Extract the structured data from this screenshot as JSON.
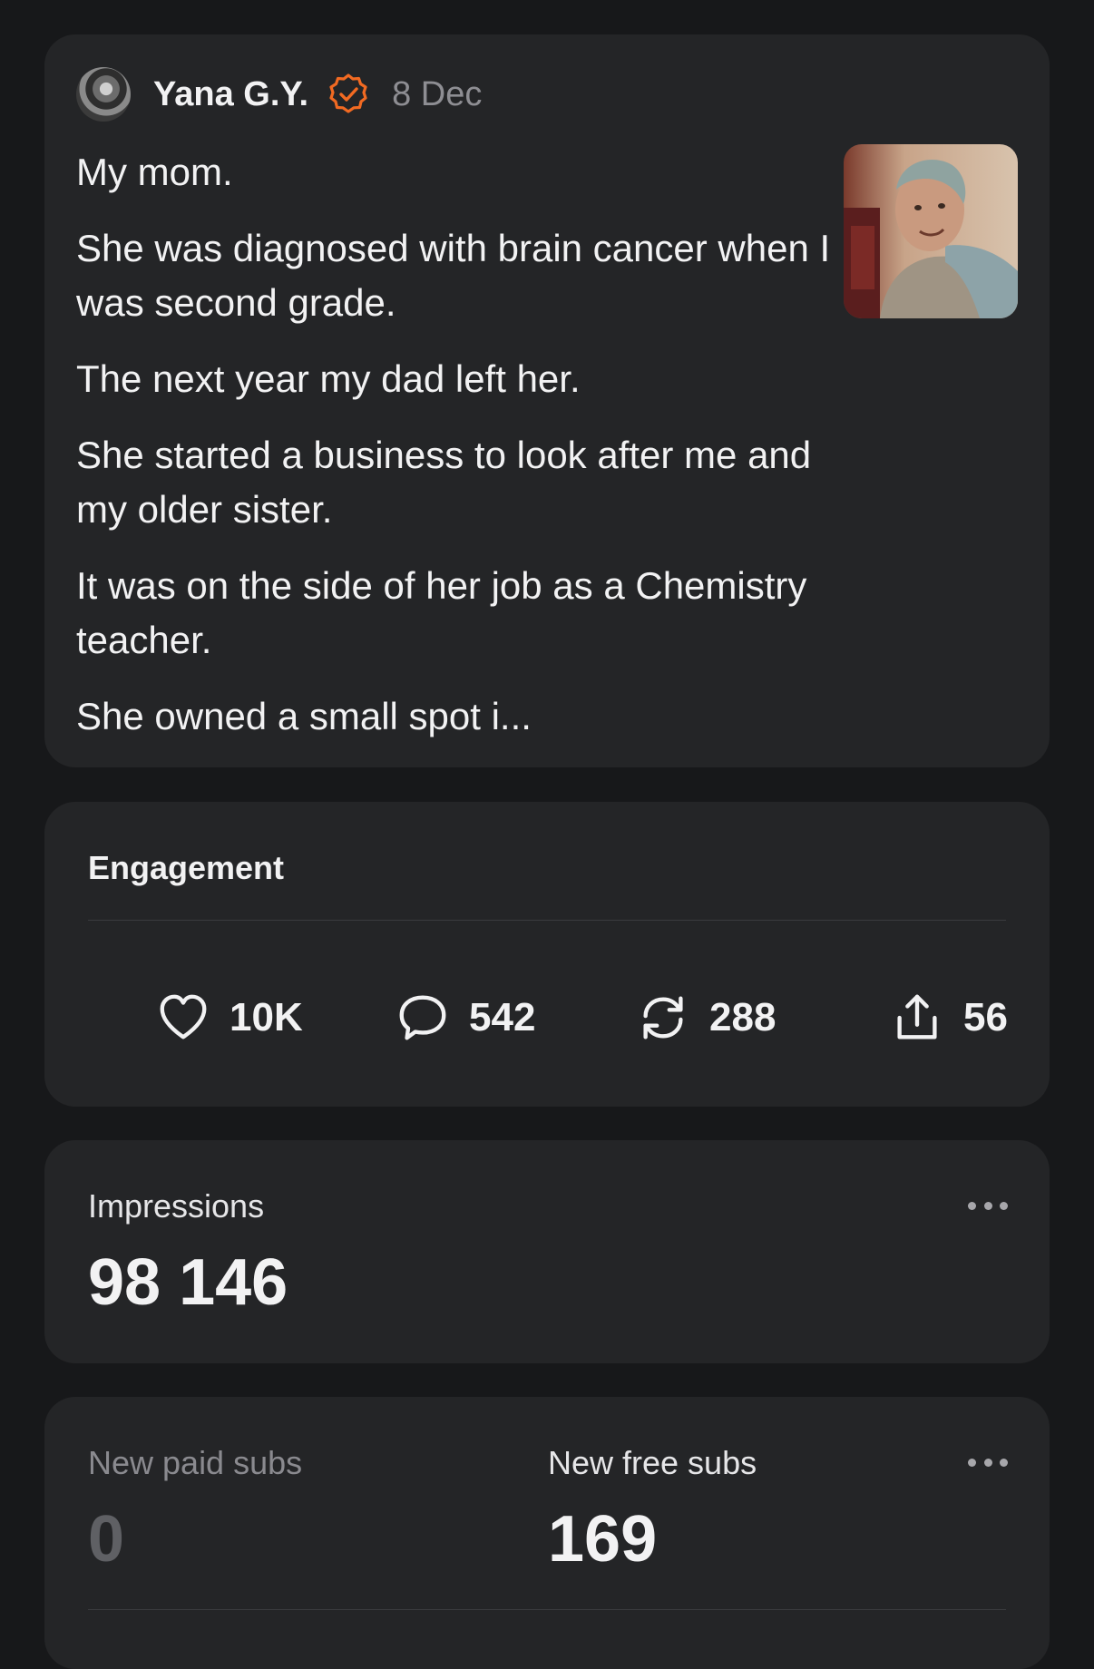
{
  "post": {
    "author": "Yana G.Y.",
    "date": "8 Dec",
    "paragraphs": [
      "My mom.",
      "She was diagnosed with brain cancer when I was second grade.",
      "The next year my dad left her.",
      "She started a business to look after me and my older sister.",
      "It was on the side of her job as a Chemistry teacher.",
      "She owned a small spot i..."
    ],
    "accent_color": "#f26a22"
  },
  "engagement": {
    "title": "Engagement",
    "likes": "10K",
    "comments": "542",
    "reposts": "288",
    "shares": "56"
  },
  "impressions": {
    "label": "Impressions",
    "value": "98 146"
  },
  "subs": {
    "paid_label": "New paid subs",
    "paid_value": "0",
    "free_label": "New free subs",
    "free_value": "169"
  },
  "icons": {
    "likes": "heart-icon",
    "comments": "comment-bubble-icon",
    "reposts": "repost-icon",
    "shares": "share-icon",
    "menu": "more-dots-icon"
  }
}
